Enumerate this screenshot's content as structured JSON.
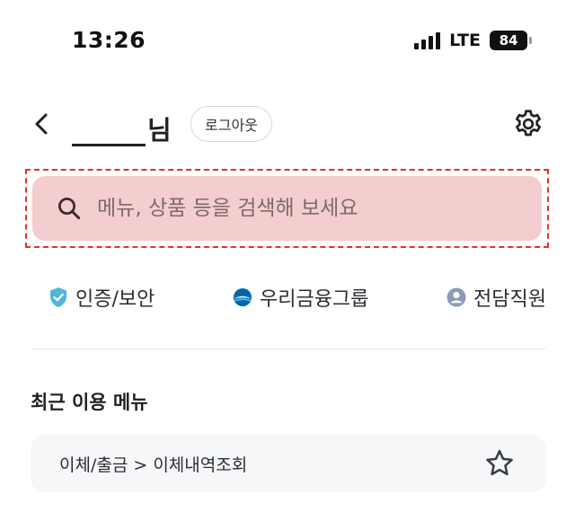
{
  "status_bar": {
    "time": "13:26",
    "network": "LTE",
    "battery": "84"
  },
  "header": {
    "name_suffix": "님",
    "logout_label": "로그아웃"
  },
  "search": {
    "placeholder": "메뉴, 상품 등을 검색해 보세요",
    "highlight_color": "#e4312b",
    "background_color": "#f4cdcf"
  },
  "quick_links": [
    {
      "label": "인증/보안",
      "icon": "shield-check-icon",
      "color": "#4fb6d8"
    },
    {
      "label": "우리금융그룹",
      "icon": "woori-logo-icon",
      "color": "#0067ac"
    },
    {
      "label": "전담직원",
      "icon": "person-icon",
      "color": "#8a9bb5"
    }
  ],
  "recent": {
    "title": "최근 이용 메뉴",
    "items": [
      {
        "label": "이체/출금 > 이체내역조회",
        "icon": "star-outline-icon"
      }
    ]
  }
}
